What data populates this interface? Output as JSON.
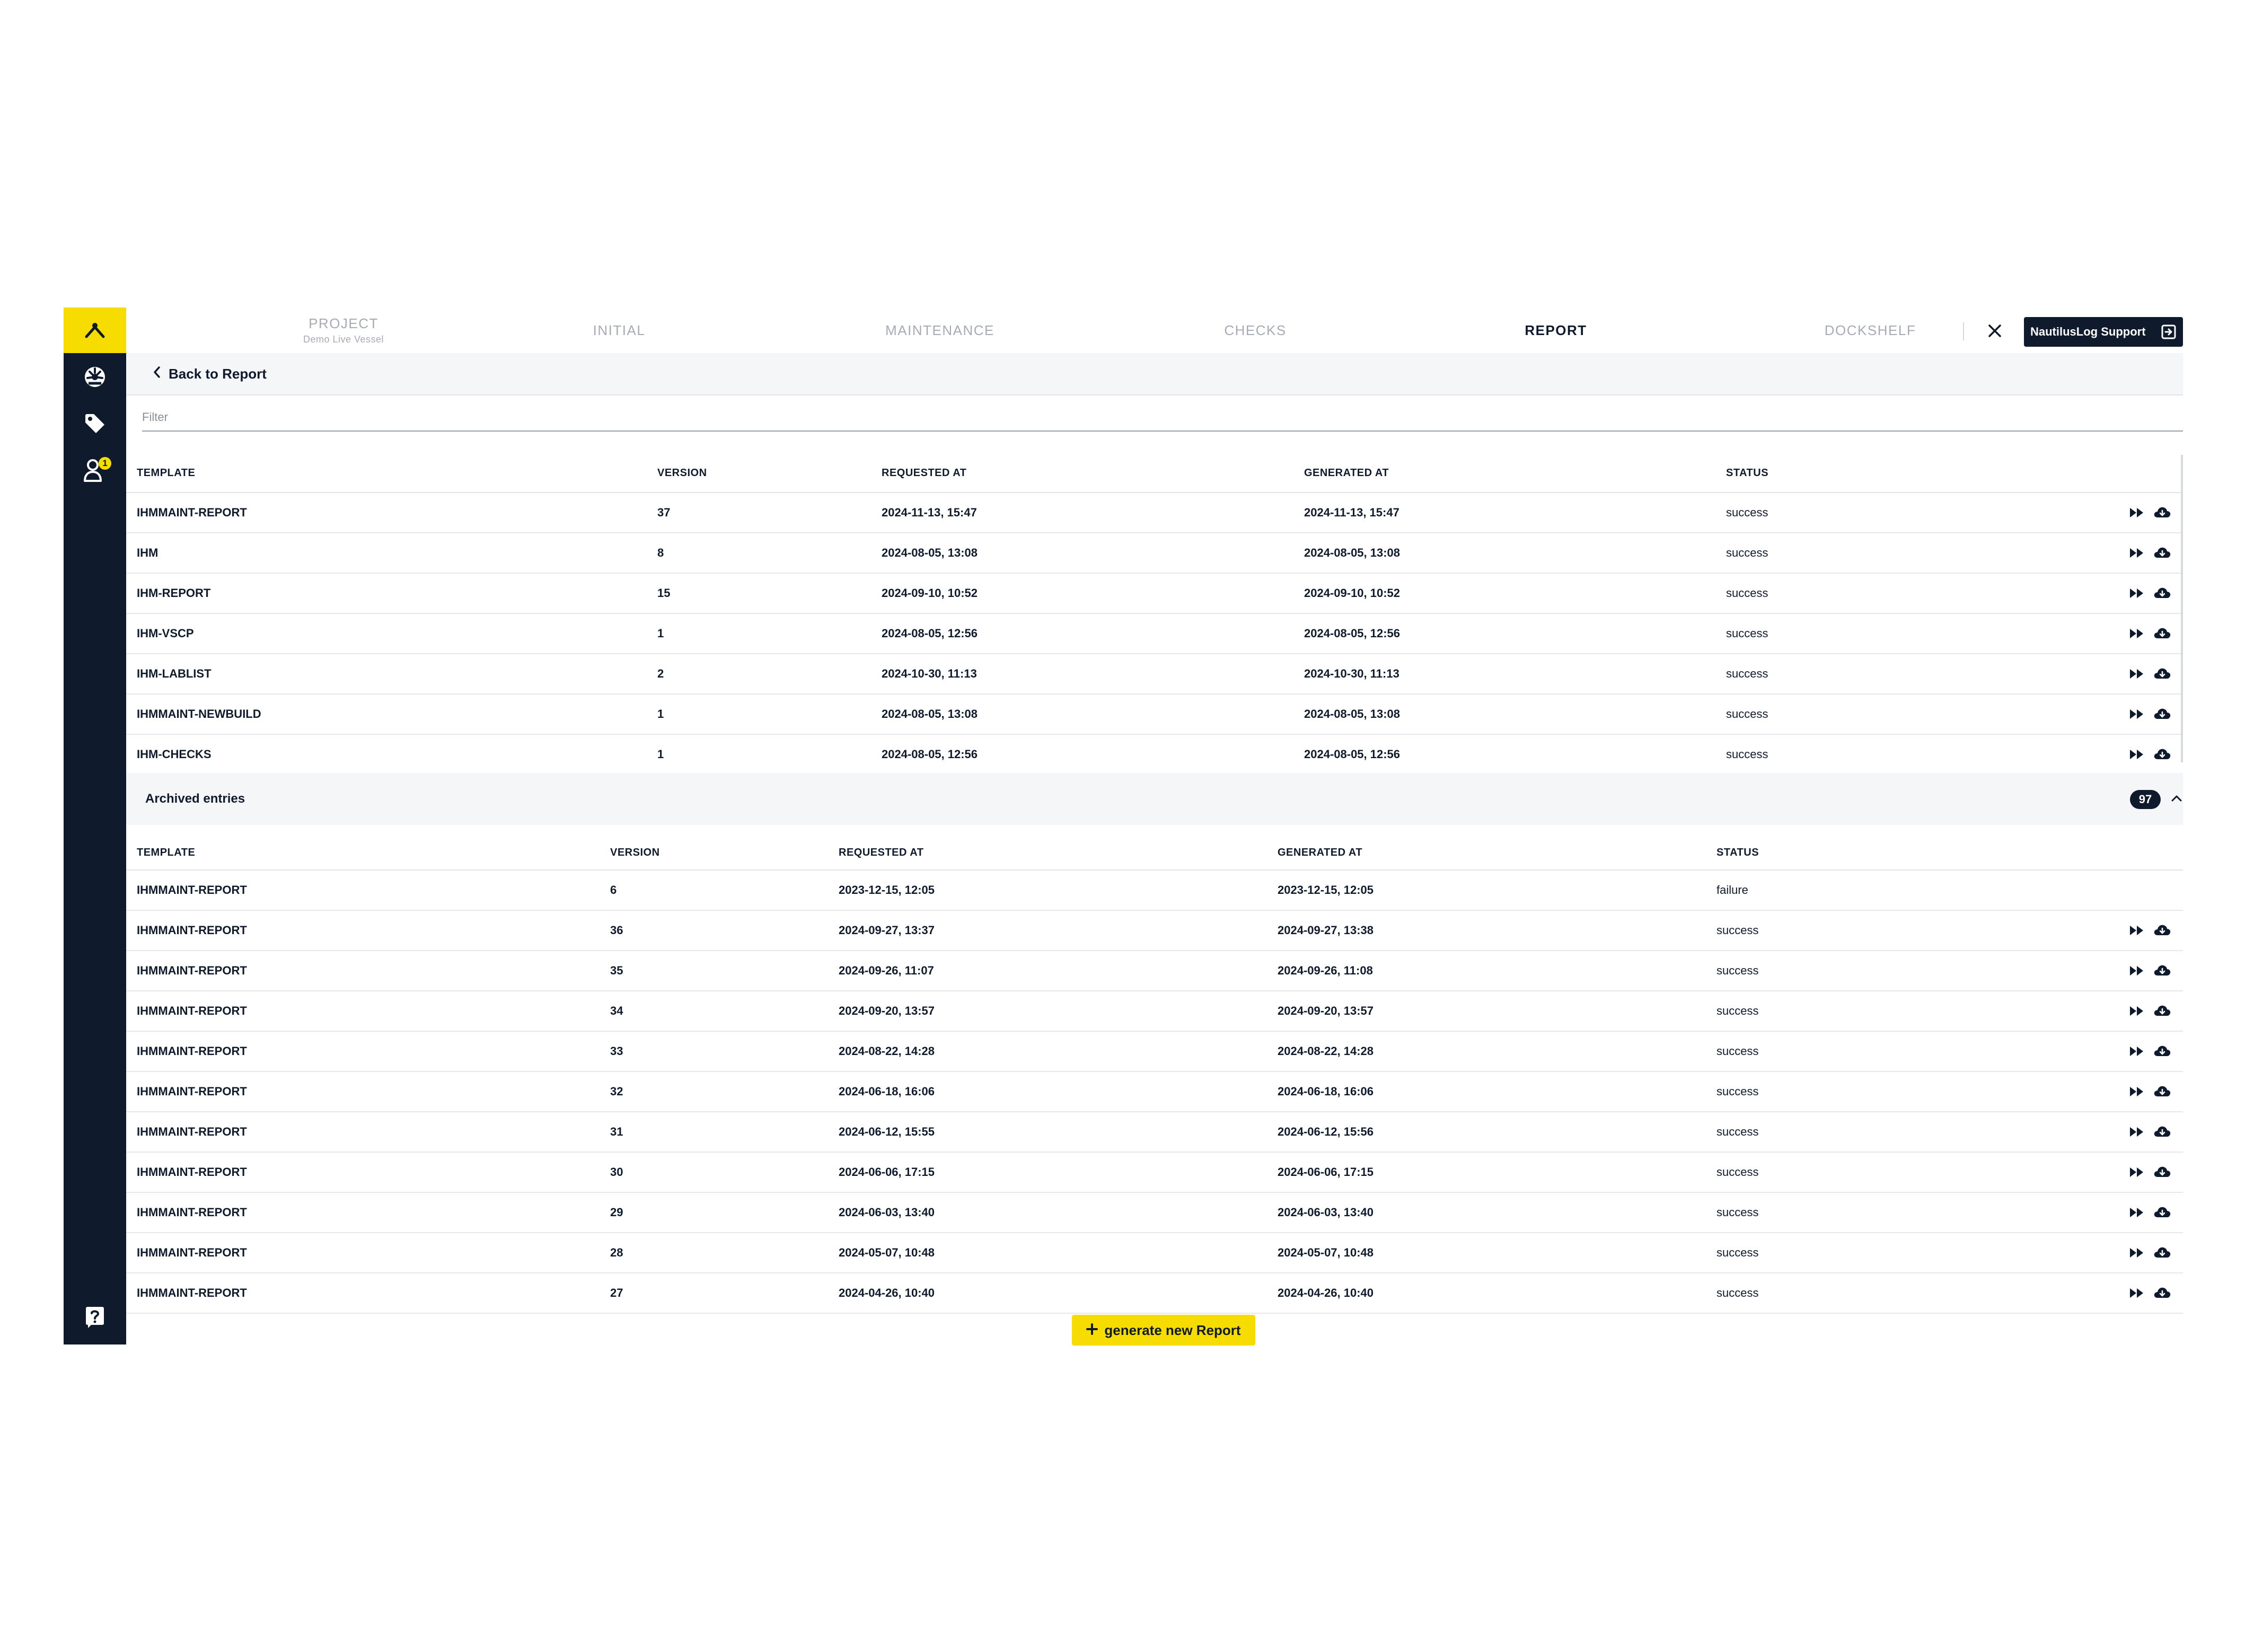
{
  "nav": {
    "tabs": [
      {
        "label": "PROJECT",
        "sub": "Demo Live Vessel"
      },
      {
        "label": "INITIAL"
      },
      {
        "label": "MAINTENANCE"
      },
      {
        "label": "CHECKS"
      },
      {
        "label": "REPORT",
        "active": true
      },
      {
        "label": "DOCKSHELF"
      }
    ],
    "support_label": "NautilusLog Support"
  },
  "sidebar": {
    "notification_count": "1"
  },
  "back_label": "Back to Report",
  "filter": {
    "placeholder": "Filter",
    "value": ""
  },
  "columns": [
    "TEMPLATE",
    "VERSION",
    "REQUESTED AT",
    "GENERATED AT",
    "STATUS"
  ],
  "current_rows": [
    {
      "template": "IHMMAINT-REPORT",
      "version": "37",
      "requested": "2024-11-13, 15:47",
      "generated": "2024-11-13, 15:47",
      "status": "success"
    },
    {
      "template": "IHM",
      "version": "8",
      "requested": "2024-08-05, 13:08",
      "generated": "2024-08-05, 13:08",
      "status": "success"
    },
    {
      "template": "IHM-REPORT",
      "version": "15",
      "requested": "2024-09-10, 10:52",
      "generated": "2024-09-10, 10:52",
      "status": "success"
    },
    {
      "template": "IHM-VSCP",
      "version": "1",
      "requested": "2024-08-05, 12:56",
      "generated": "2024-08-05, 12:56",
      "status": "success"
    },
    {
      "template": "IHM-LABLIST",
      "version": "2",
      "requested": "2024-10-30, 11:13",
      "generated": "2024-10-30, 11:13",
      "status": "success"
    },
    {
      "template": "IHMMAINT-NEWBUILD",
      "version": "1",
      "requested": "2024-08-05, 13:08",
      "generated": "2024-08-05, 13:08",
      "status": "success"
    },
    {
      "template": "IHM-CHECKS",
      "version": "1",
      "requested": "2024-08-05, 12:56",
      "generated": "2024-08-05, 12:56",
      "status": "success"
    }
  ],
  "archived": {
    "label": "Archived entries",
    "count": "97",
    "rows": [
      {
        "template": "IHMMAINT-REPORT",
        "version": "6",
        "requested": "2023-12-15, 12:05",
        "generated": "2023-12-15, 12:05",
        "status": "failure"
      },
      {
        "template": "IHMMAINT-REPORT",
        "version": "36",
        "requested": "2024-09-27, 13:37",
        "generated": "2024-09-27, 13:38",
        "status": "success"
      },
      {
        "template": "IHMMAINT-REPORT",
        "version": "35",
        "requested": "2024-09-26, 11:07",
        "generated": "2024-09-26, 11:08",
        "status": "success"
      },
      {
        "template": "IHMMAINT-REPORT",
        "version": "34",
        "requested": "2024-09-20, 13:57",
        "generated": "2024-09-20, 13:57",
        "status": "success"
      },
      {
        "template": "IHMMAINT-REPORT",
        "version": "33",
        "requested": "2024-08-22, 14:28",
        "generated": "2024-08-22, 14:28",
        "status": "success"
      },
      {
        "template": "IHMMAINT-REPORT",
        "version": "32",
        "requested": "2024-06-18, 16:06",
        "generated": "2024-06-18, 16:06",
        "status": "success"
      },
      {
        "template": "IHMMAINT-REPORT",
        "version": "31",
        "requested": "2024-06-12, 15:55",
        "generated": "2024-06-12, 15:56",
        "status": "success"
      },
      {
        "template": "IHMMAINT-REPORT",
        "version": "30",
        "requested": "2024-06-06, 17:15",
        "generated": "2024-06-06, 17:15",
        "status": "success"
      },
      {
        "template": "IHMMAINT-REPORT",
        "version": "29",
        "requested": "2024-06-03, 13:40",
        "generated": "2024-06-03, 13:40",
        "status": "success"
      },
      {
        "template": "IHMMAINT-REPORT",
        "version": "28",
        "requested": "2024-05-07, 10:48",
        "generated": "2024-05-07, 10:48",
        "status": "success"
      },
      {
        "template": "IHMMAINT-REPORT",
        "version": "27",
        "requested": "2024-04-26, 10:40",
        "generated": "2024-04-26, 10:40",
        "status": "success"
      }
    ]
  },
  "generate_label": "generate new Report",
  "colors": {
    "accent": "#f7dc00",
    "navy": "#0f1b2d"
  },
  "icons": [
    "logo-icon",
    "dashboard-icon",
    "tag-icon",
    "user-icon",
    "help-icon",
    "close-icon",
    "logout-icon",
    "open-icon",
    "download-icon",
    "chevron-up-icon",
    "chevron-left-icon",
    "plus-icon"
  ]
}
